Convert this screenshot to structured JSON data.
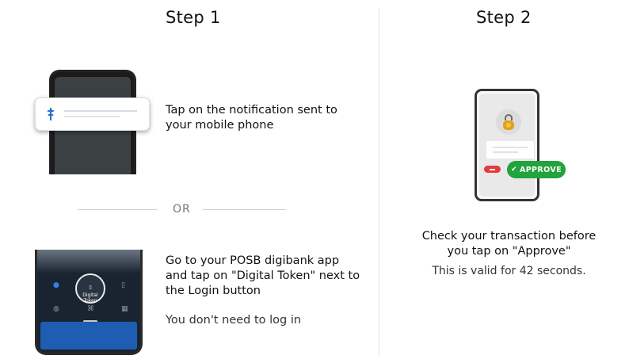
{
  "step1": {
    "title": "Step 1",
    "notification_text": "Tap on the notification sent to your mobile phone",
    "or_label": "OR",
    "app_text": "Go to your POSB digibank app and tap on \"Digital Token\" next to the Login button",
    "no_login_text": "You don't need to log in",
    "digital_token_label": "Digital Token"
  },
  "step2": {
    "title": "Step 2",
    "approve_label": "APPROVE",
    "check_text": "Check your transaction before you tap on \"Approve\"",
    "validity_text": "This is valid for 42 seconds."
  },
  "colors": {
    "approve_green": "#22a33d",
    "reject_red": "#e33b3b",
    "notification_blue": "#1f6fd6",
    "bank_blue": "#1f5db2"
  },
  "icons": [
    "notification-app-icon",
    "padlock-icon",
    "check-icon",
    "digital-token-icon"
  ]
}
